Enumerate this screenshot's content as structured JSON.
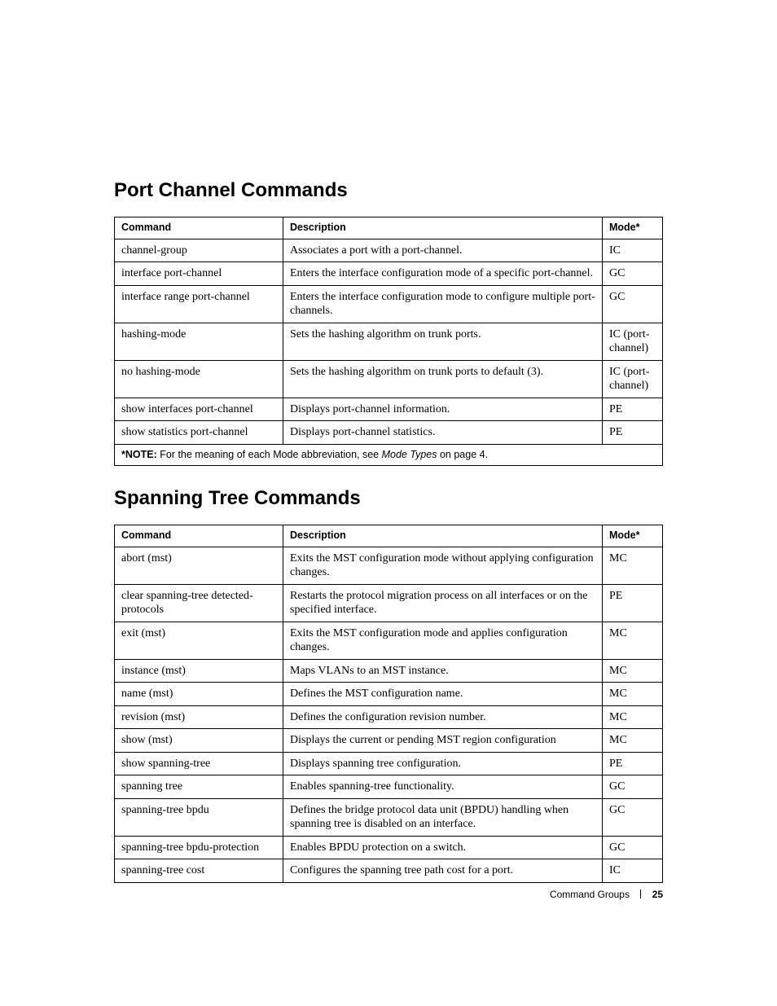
{
  "section1": {
    "title": "Port Channel Commands",
    "headers": {
      "c1": "Command",
      "c2": "Description",
      "c3": "Mode*"
    },
    "rows": [
      {
        "cmd": "channel-group",
        "desc": "Associates a port with a port-channel.",
        "mode": "IC"
      },
      {
        "cmd": "interface port-channel",
        "desc": "Enters the interface configuration mode of a specific port-channel.",
        "mode": "GC"
      },
      {
        "cmd": "interface range port-channel",
        "desc": "Enters the interface configuration mode to configure multiple port-channels.",
        "mode": "GC"
      },
      {
        "cmd": "hashing-mode",
        "desc": "Sets the hashing algorithm on trunk ports.",
        "mode": "IC (port-channel)"
      },
      {
        "cmd": "no hashing-mode",
        "desc": "Sets the hashing algorithm on trunk ports to default (3).",
        "mode": "IC (port-channel)"
      },
      {
        "cmd": "show interfaces port-channel",
        "desc": "Displays port-channel information.",
        "mode": "PE"
      },
      {
        "cmd": "show statistics port-channel",
        "desc": "Displays port-channel statistics.",
        "mode": "PE"
      }
    ],
    "note": {
      "label": "*NOTE:",
      "text_before": " For the meaning of each Mode abbreviation, see ",
      "italic": "Mode Types",
      "text_after": " on page 4."
    }
  },
  "section2": {
    "title": "Spanning Tree Commands",
    "headers": {
      "c1": "Command",
      "c2": "Description",
      "c3": "Mode*"
    },
    "rows": [
      {
        "cmd": "abort (mst)",
        "desc": "Exits the MST configuration mode without applying configuration changes.",
        "mode": "MC"
      },
      {
        "cmd": "clear spanning-tree detected-protocols",
        "desc": "Restarts the protocol migration process on all interfaces or on the specified interface.",
        "mode": "PE"
      },
      {
        "cmd": "exit (mst)",
        "desc": "Exits the MST configuration mode and applies configuration changes.",
        "mode": "MC"
      },
      {
        "cmd": "instance (mst)",
        "desc": "Maps VLANs to an MST instance.",
        "mode": "MC"
      },
      {
        "cmd": "name (mst)",
        "desc": "Defines the MST configuration name.",
        "mode": "MC"
      },
      {
        "cmd": "revision (mst)",
        "desc": "Defines the configuration revision number.",
        "mode": "MC"
      },
      {
        "cmd": "show (mst)",
        "desc": "Displays the current or pending MST region configuration",
        "mode": "MC"
      },
      {
        "cmd": "show spanning-tree",
        "desc": "Displays spanning tree configuration.",
        "mode": "PE"
      },
      {
        "cmd": "spanning tree",
        "desc": "Enables spanning-tree functionality.",
        "mode": "GC"
      },
      {
        "cmd": "spanning-tree bpdu",
        "desc": "Defines the bridge protocol data unit (BPDU) handling when spanning tree is disabled on an interface.",
        "mode": "GC"
      },
      {
        "cmd": "spanning-tree bpdu-protection",
        "desc": "Enables BPDU protection on a switch.",
        "mode": "GC"
      },
      {
        "cmd": "spanning-tree cost",
        "desc": "Configures the spanning tree path cost for a port.",
        "mode": "IC"
      }
    ]
  },
  "footer": {
    "section": "Command Groups",
    "page": "25"
  }
}
